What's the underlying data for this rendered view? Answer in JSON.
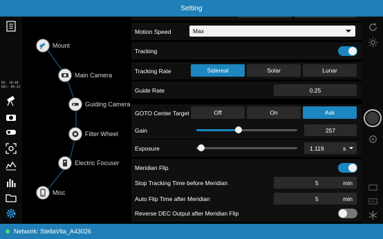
{
  "window": {
    "title": "Setting"
  },
  "status": {
    "network_text": "Network: StellaVita_A43026",
    "indicator_color": "#3fe07a"
  },
  "left_toolbar": {
    "ra_label": "RA:",
    "ra_value": "18:40",
    "dec_label": "DEC:",
    "dec_value": "89:23",
    "icons": [
      "checklist-icon",
      "telescope-icon",
      "camera-icon",
      "guide-camera-icon",
      "focus-icon",
      "histogram-icon",
      "bars-chart-icon",
      "folder-icon",
      "gear-icon"
    ]
  },
  "nav": {
    "items": [
      {
        "label": "Mount",
        "icon": "mount-icon"
      },
      {
        "label": "Main Camera",
        "icon": "main-camera-icon"
      },
      {
        "label": "Guiding Camera",
        "icon": "guiding-camera-icon"
      },
      {
        "label": "Filter Wheel",
        "icon": "filter-wheel-icon"
      },
      {
        "label": "Electric Focuser",
        "icon": "focuser-icon"
      },
      {
        "label": "Misc",
        "icon": "misc-icon"
      }
    ]
  },
  "settings": {
    "motion_speed": {
      "label": "Motion Speed",
      "value": "Max"
    },
    "tracking": {
      "label": "Tracking",
      "on": true
    },
    "tracking_rate": {
      "label": "Tracking Rate",
      "options": [
        "Sidereal",
        "Solar",
        "Lunar"
      ],
      "selected": "Sidereal"
    },
    "guide_rate": {
      "label": "Guide Rate",
      "value": "0.25"
    },
    "goto_center_target": {
      "label": "GOTO Center Target",
      "options": [
        "Off",
        "On",
        "Ask"
      ],
      "selected": "Ask"
    },
    "gain": {
      "label": "Gain",
      "value": "257",
      "level_fraction": 0.42
    },
    "exposure": {
      "label": "Exposure",
      "value": "1.119",
      "unit": "s",
      "level_fraction": 0.05
    },
    "meridian_flip": {
      "label": "Meridian Flip",
      "on": true
    },
    "stop_tracking": {
      "label": "Stop Tracking Time before Meridian",
      "value": "5",
      "unit": "min"
    },
    "auto_flip": {
      "label": "Auto Flip Time after Meridian",
      "value": "5",
      "unit": "min"
    },
    "reverse_dec": {
      "label": "Reverse DEC Output after Meridian Flip",
      "on": false
    }
  },
  "right_toolbar": {
    "icons": [
      "refresh-icon",
      "brightness-icon",
      "shutter-button",
      "camera-settings-icon",
      "frame-icon",
      "frame-icon",
      "cooler-icon"
    ]
  },
  "colors": {
    "accent": "#1d86c0",
    "titlebar": "#1f7fb6",
    "row": "#101010",
    "field": "#2a2a2a"
  }
}
